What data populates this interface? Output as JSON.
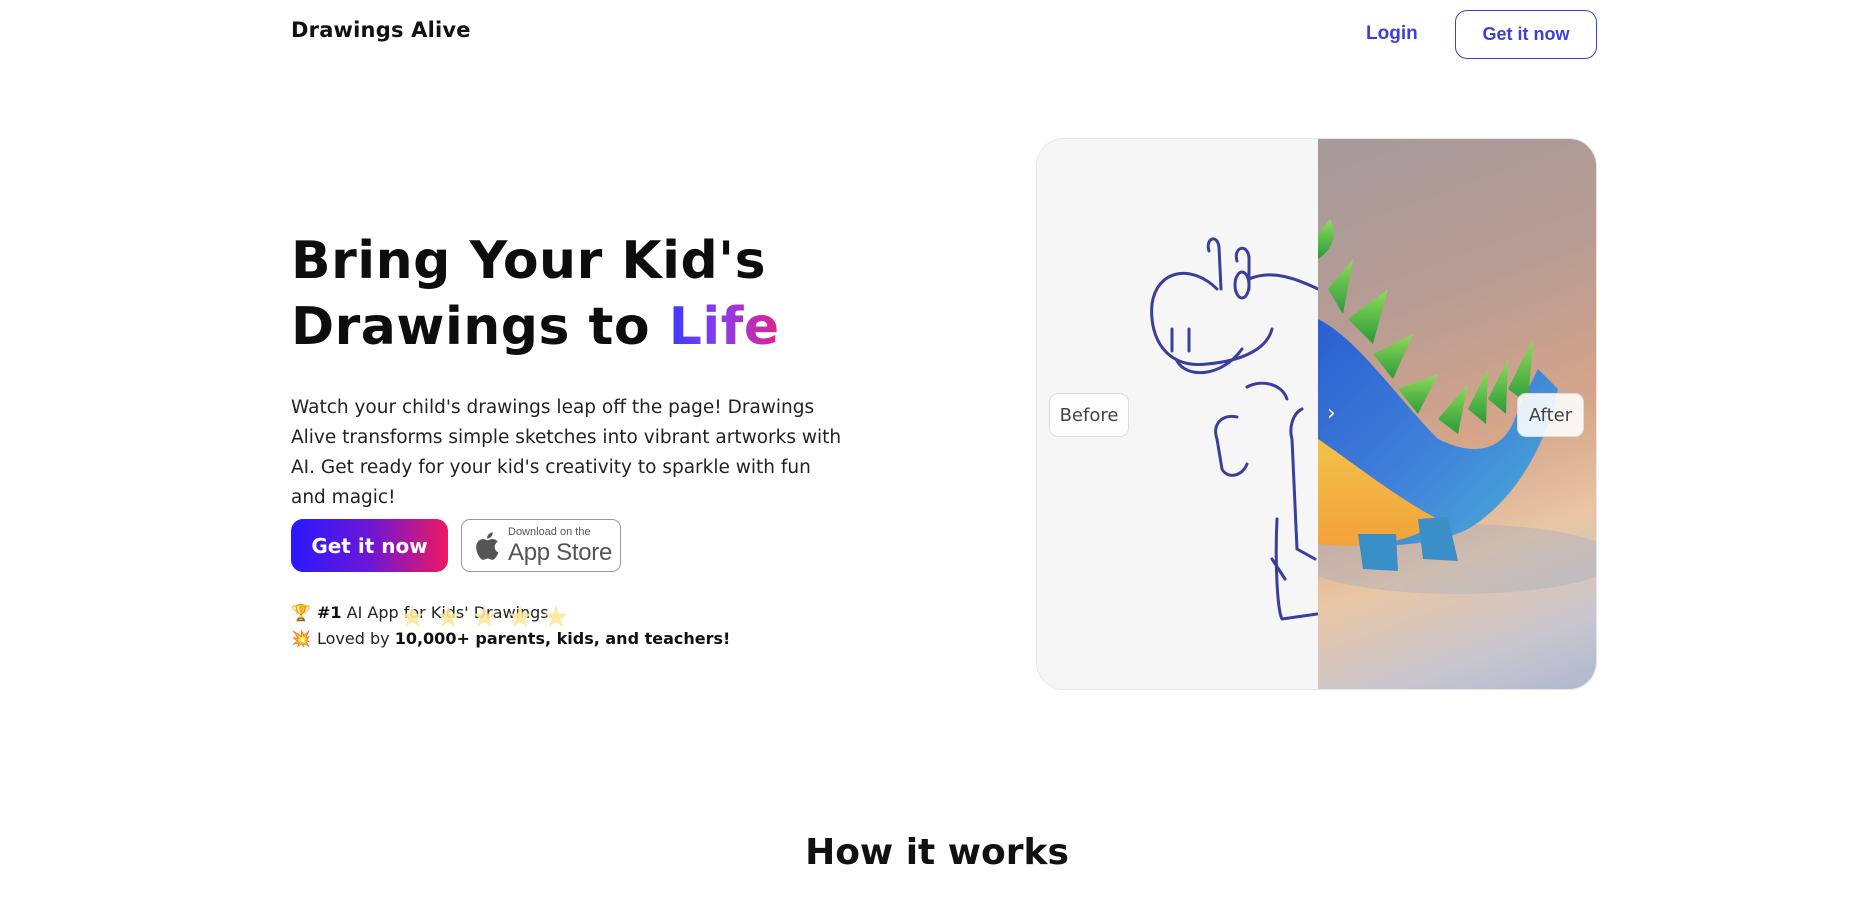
{
  "nav": {
    "brand": "Drawings Alive",
    "login": "Login",
    "cta": "Get it now"
  },
  "hero": {
    "title_line1": "Bring Your Kid's",
    "title_line2_prefix": "Drawings to",
    "title_highlight": "Life",
    "description": "Watch your child's drawings leap off the page! Drawings Alive transforms simple sketches into vibrant artworks with AI. Get ready for your kid's creativity to sparkle with fun and magic!",
    "cta_primary": "Get it now",
    "appstore_small": "Download on the",
    "appstore_big": "App Store",
    "stat1_emoji": "🏆",
    "stat1_bold": "#1",
    "stat1_text": "AI App for Kids' Drawings",
    "stat2_emoji": "💥",
    "stat2_text": "Loved by",
    "stat2_bold": "10,000+ parents, kids, and teachers!",
    "stars": [
      "★",
      "★",
      "★",
      "★",
      "★"
    ]
  },
  "compare": {
    "before_label": "Before",
    "after_label": "After",
    "divider_arrow": "›"
  },
  "section": {
    "how_it_works": "How it works"
  },
  "colors": {
    "accent": "#3f3fd8",
    "gradient_start": "#2a18ff",
    "gradient_end": "#ee1860"
  }
}
